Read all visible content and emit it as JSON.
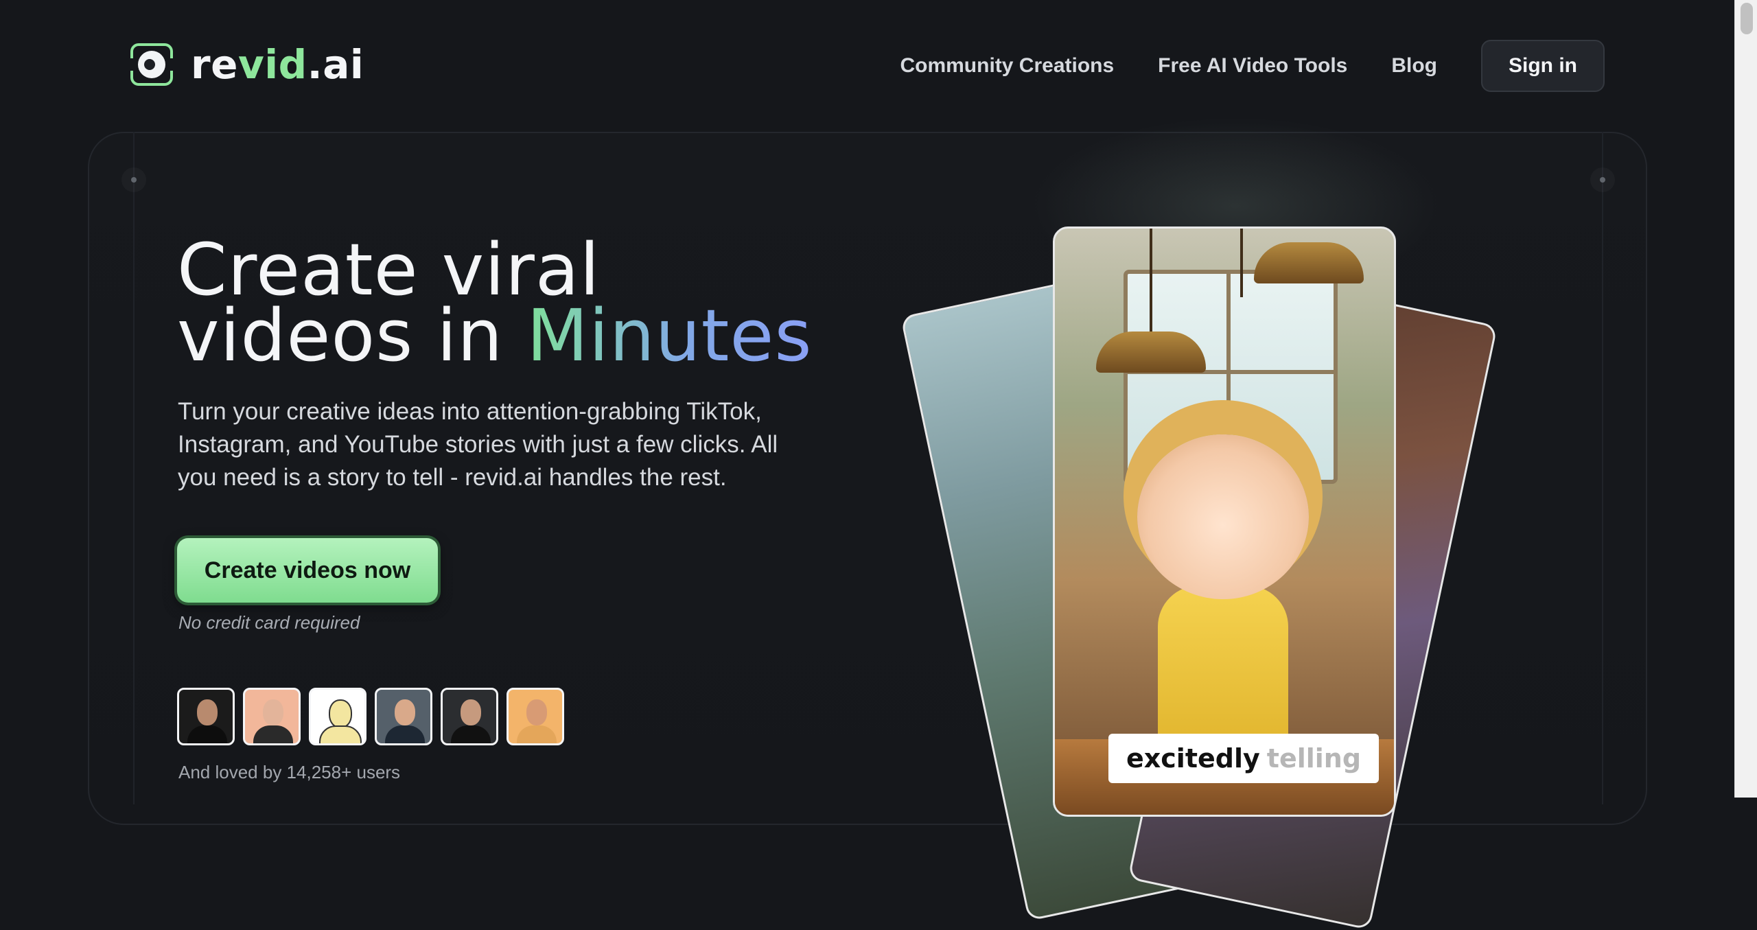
{
  "brand": {
    "name_start": "re",
    "name_accent": "vid",
    "name_end": ".ai"
  },
  "nav": {
    "links": [
      "Community Creations",
      "Free AI Video Tools",
      "Blog"
    ],
    "signin_label": "Sign in"
  },
  "hero": {
    "headline_line1": "Create viral",
    "headline_line2_start": "videos in ",
    "headline_accent": "Minutes",
    "subtitle": "Turn your creative ideas into attention-grabbing TikTok, Instagram, and YouTube stories with just a few clicks. All you need is a story to tell - revid.ai handles the rest.",
    "cta_label": "Create videos now",
    "cta_note": "No credit card required",
    "social_proof": "And loved by 14,258+ users"
  },
  "preview": {
    "caption_word_1": "excitedly",
    "caption_word_2": "telling"
  },
  "colors": {
    "background": "#15171b",
    "accent_green": "#8ee69c",
    "accent_blue": "#8aa0f5",
    "cta_green": "#7fdc8f"
  },
  "icons": [
    "revid-logo-icon"
  ]
}
